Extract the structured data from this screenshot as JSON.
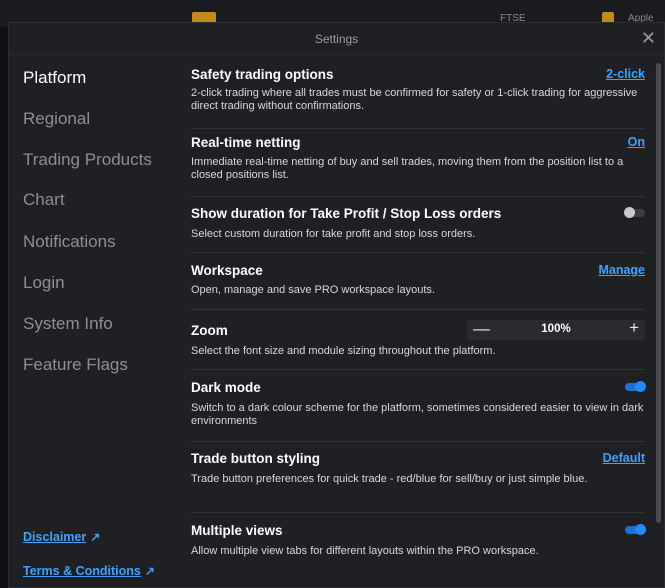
{
  "background": {
    "top_text_1": "FTSE",
    "top_text_2": "Apple"
  },
  "dialog": {
    "title": "Settings",
    "close_glyph": "✕"
  },
  "sidebar": {
    "items": [
      {
        "label": "Platform",
        "active": true
      },
      {
        "label": "Regional"
      },
      {
        "label": "Trading Products"
      },
      {
        "label": "Chart"
      },
      {
        "label": "Notifications"
      },
      {
        "label": "Login"
      },
      {
        "label": "System Info"
      },
      {
        "label": "Feature Flags"
      }
    ],
    "links": [
      {
        "label": "Disclaimer",
        "icon": "external-link-icon"
      },
      {
        "label": "Terms & Conditions",
        "icon": "external-link-icon"
      }
    ]
  },
  "settings": {
    "safety": {
      "title": "Safety trading options",
      "action": "2-click",
      "desc": "2-click trading where all trades must be confirmed for safety or 1-click trading for aggressive direct trading without confirmations."
    },
    "netting": {
      "title": "Real-time netting",
      "action": "On",
      "desc": "Immediate real-time netting of buy and sell trades, moving them from the position list to a closed positions list."
    },
    "duration": {
      "title": "Show duration for Take Profit / Stop Loss orders",
      "toggle": false,
      "desc": "Select custom duration for take profit and stop loss orders."
    },
    "workspace": {
      "title": "Workspace",
      "action": "Manage",
      "desc": "Open, manage and save PRO workspace layouts."
    },
    "zoom": {
      "title": "Zoom",
      "minus": "—",
      "value": "100%",
      "plus": "+",
      "desc": "Select the font size and module sizing throughout the platform."
    },
    "dark_mode": {
      "title": "Dark mode",
      "toggle": true,
      "desc": "Switch to a dark colour scheme for the platform, sometimes considered easier to view in dark environments"
    },
    "trade_button": {
      "title": "Trade button styling",
      "action": "Default",
      "desc": "Trade button preferences for quick trade - red/blue for sell/buy or just simple blue."
    },
    "multiple_views": {
      "title": "Multiple views",
      "toggle": true,
      "desc": "Allow multiple view tabs for different layouts within the PRO workspace."
    }
  },
  "colors": {
    "accent": "#3ea3ff",
    "toggle_on": "#1f8dff",
    "background": "#1f2023"
  }
}
